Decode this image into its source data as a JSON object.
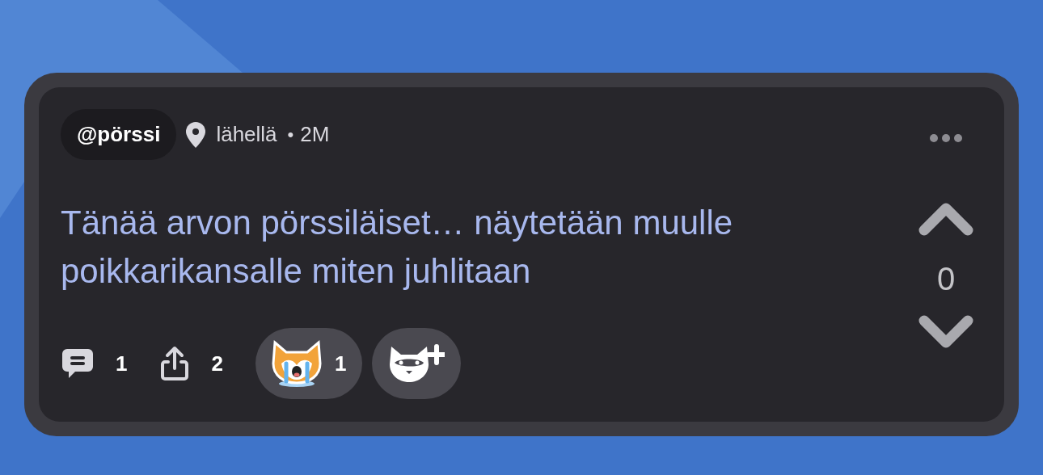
{
  "post": {
    "author": "@pörssi",
    "location": "lähellä",
    "separator": "•",
    "time": "2M",
    "text": "Tänää arvon pörssiläiset… näytetään muulle poikkarikansalle miten juhlitaan"
  },
  "actions": [
    {
      "kind": "comment",
      "count": "1"
    },
    {
      "kind": "share",
      "count": "2"
    }
  ],
  "reactions": [
    {
      "kind": "crying-cat",
      "count": "1"
    }
  ],
  "votes": {
    "score": "0"
  }
}
